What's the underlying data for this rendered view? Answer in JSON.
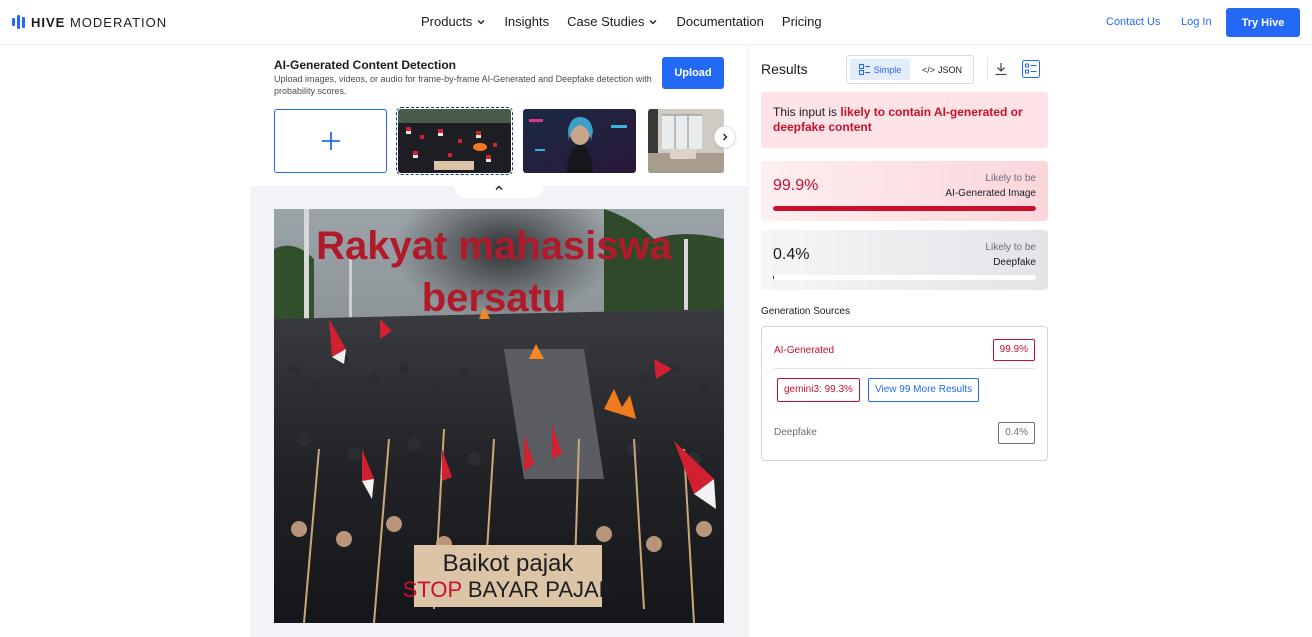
{
  "header": {
    "logo_bold": "HIVE",
    "logo_light": "MODERATION",
    "nav": [
      {
        "label": "Products",
        "has_dropdown": true
      },
      {
        "label": "Insights",
        "has_dropdown": false
      },
      {
        "label": "Case Studies",
        "has_dropdown": true
      },
      {
        "label": "Documentation",
        "has_dropdown": false
      },
      {
        "label": "Pricing",
        "has_dropdown": false
      }
    ],
    "contact_label": "Contact Us",
    "login_label": "Log In",
    "try_label": "Try Hive"
  },
  "detector": {
    "title": "AI-Generated Content Detection",
    "description": "Upload images, videos, or audio for frame-by-frame AI-Generated and Deepfake detection with probability scores.",
    "upload_label": "Upload"
  },
  "preview": {
    "headline_line1": "Rakyat mahasiswa",
    "headline_line2": "bersatu",
    "banner_line1": "Baikot pajak",
    "banner_line2_red": "STOP",
    "banner_line2_black": "BAYAR PAJAK"
  },
  "results": {
    "title": "Results",
    "toggle_simple": "Simple",
    "toggle_json": "JSON",
    "alert_prefix": "This input is ",
    "alert_bold": "likely to contain AI-generated or deepfake content",
    "ai": {
      "value": "99.9%",
      "fraction": 0.999,
      "label1": "Likely to be",
      "label2": "AI-Generated Image"
    },
    "deepfake": {
      "value": "0.4%",
      "fraction": 0.004,
      "label1": "Likely to be",
      "label2": "Deepfake"
    },
    "generation_sources_title": "Generation Sources",
    "gen_ai_label": "AI-Generated",
    "gen_ai_value": "99.9%",
    "gen_source": "gemini3: 99.3%",
    "view_more": "View 99 More Results",
    "gen_df_label": "Deepfake",
    "gen_df_value": "0.4%"
  },
  "colors": {
    "accent": "#2469f5",
    "danger": "#c8102e"
  }
}
